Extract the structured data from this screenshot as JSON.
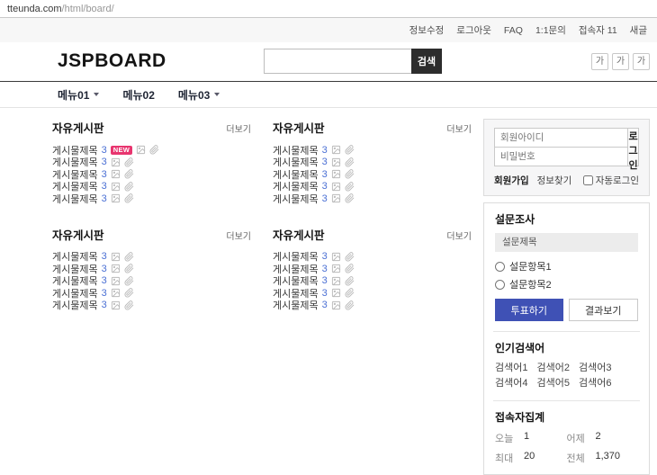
{
  "browser": {
    "url_host": "tteunda.com",
    "url_path": "/html/board/"
  },
  "utility_nav": {
    "items": [
      "정보수정",
      "로그아웃",
      "FAQ",
      "1:1문의",
      "접속자 11",
      "새글"
    ]
  },
  "header": {
    "logo": "JSPBOARD",
    "search_button_label": "검색",
    "font_size_buttons": [
      "가",
      "가",
      "가"
    ]
  },
  "menu": {
    "items": [
      {
        "label": "메뉴01"
      },
      {
        "label": "메뉴02"
      },
      {
        "label": "메뉴03"
      }
    ]
  },
  "boards": {
    "title": "자유게시판",
    "more_label": "더보기",
    "item_title": "게시물제목",
    "item_count": "3",
    "new_badge": "NEW"
  },
  "sidebar": {
    "login": {
      "id_placeholder": "회원아이디",
      "password_placeholder": "비밀번호",
      "login_button_label": "로그인",
      "signup_label": "회원가입",
      "find_info_label": "정보찾기",
      "auto_login_label": "자동로그인"
    },
    "survey": {
      "title": "설문조사",
      "subject": "설문제목",
      "options": [
        "설문항목1",
        "설문항목2"
      ],
      "vote_button_label": "투표하기",
      "result_button_label": "결과보기"
    },
    "popular_keywords": {
      "title": "인기검색어",
      "terms": [
        "검색어1",
        "검색어2",
        "검색어3",
        "검색어4",
        "검색어5",
        "검색어6"
      ]
    },
    "visitor_stats": {
      "title": "접속자집계",
      "stats": [
        {
          "label": "오늘",
          "value": "1"
        },
        {
          "label": "어제",
          "value": "2"
        },
        {
          "label": "최대",
          "value": "20"
        },
        {
          "label": "전체",
          "value": "1,370"
        }
      ]
    }
  },
  "colors": {
    "new_badge": "#e8356f",
    "count_link": "#4a6fd4",
    "vote_button": "#3f51b5",
    "search_button_bg": "#2d2d2d"
  }
}
